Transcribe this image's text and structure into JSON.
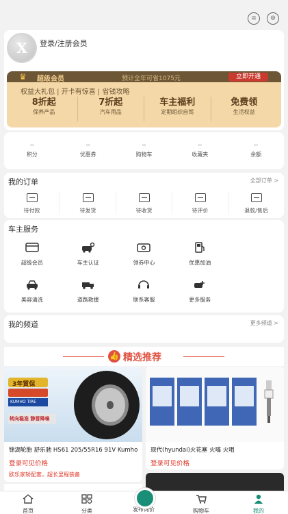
{
  "header": {
    "icons": [
      "message-icon",
      "settings-icon"
    ]
  },
  "profile": {
    "avatar_letter": "X",
    "login_label": "登录/注册会员"
  },
  "vip": {
    "title": "超级会员",
    "save_text": "预计全年可省1075元",
    "open_button": "立即开通",
    "subtitle": "权益大礼包 | 开卡有惊喜 | 省钱攻略",
    "benefits": [
      {
        "big": "8折起",
        "small": "保养产品"
      },
      {
        "big": "7折起",
        "small": "汽车用品"
      },
      {
        "big": "车主福利",
        "small": "定期组织自驾"
      },
      {
        "big": "免费领",
        "small": "生活权益"
      }
    ],
    "colors": {
      "head": "#6d5636",
      "card": "#f4d8a8",
      "button": "#c93a2f"
    }
  },
  "stats": [
    {
      "value": "--",
      "label": "积分"
    },
    {
      "value": "--",
      "label": "优惠券"
    },
    {
      "value": "--",
      "label": "购物车"
    },
    {
      "value": "--",
      "label": "收藏夹"
    },
    {
      "value": "--",
      "label": "余额"
    }
  ],
  "orders": {
    "title": "我的订单",
    "more": "全部订单 >",
    "items": [
      {
        "label": "待付款",
        "icon": "wallet-icon"
      },
      {
        "label": "待发货",
        "icon": "box-icon"
      },
      {
        "label": "待收货",
        "icon": "delivery-icon"
      },
      {
        "label": "待评价",
        "icon": "review-icon"
      },
      {
        "label": "退款/售后",
        "icon": "refund-icon"
      }
    ]
  },
  "service": {
    "title": "车主服务",
    "items": [
      {
        "label": "超级会员",
        "icon": "card-icon"
      },
      {
        "label": "车主认证",
        "icon": "car-user-icon"
      },
      {
        "label": "领券中心",
        "icon": "coupon-icon"
      },
      {
        "label": "优惠加油",
        "icon": "fuel-icon"
      },
      {
        "label": "美容清洗",
        "icon": "car-wash-icon"
      },
      {
        "label": "道路救援",
        "icon": "tow-truck-icon"
      },
      {
        "label": "联系客服",
        "icon": "headset-icon"
      },
      {
        "label": "更多服务",
        "icon": "more-service-icon"
      }
    ]
  },
  "channel": {
    "title": "我的频道",
    "more": "更多频道 >"
  },
  "recommend": {
    "title": "精选推荐",
    "accent": "#e05141",
    "products": [
      {
        "name": "锦湖轮胎 舒乐驰 HS61 205/55R16 91V Kumho",
        "price": "登录可见价格",
        "note": "欧乐家轿配套，超长里程装备",
        "image_badge": "3年質保",
        "image_brand": "KUMHO TIRE",
        "image_slogan": "转向稳准 静音降噪"
      },
      {
        "name": "现代(hyundai)火花塞 火嘴 火咀",
        "price": "登录可见价格",
        "note": ""
      }
    ]
  },
  "tabbar": [
    {
      "label": "首页",
      "icon": "home-icon"
    },
    {
      "label": "分类",
      "icon": "category-icon"
    },
    {
      "label": "发布询价",
      "icon": "publish-icon"
    },
    {
      "label": "购物车",
      "icon": "cart-icon"
    },
    {
      "label": "我的",
      "icon": "user-icon",
      "active": true
    }
  ]
}
